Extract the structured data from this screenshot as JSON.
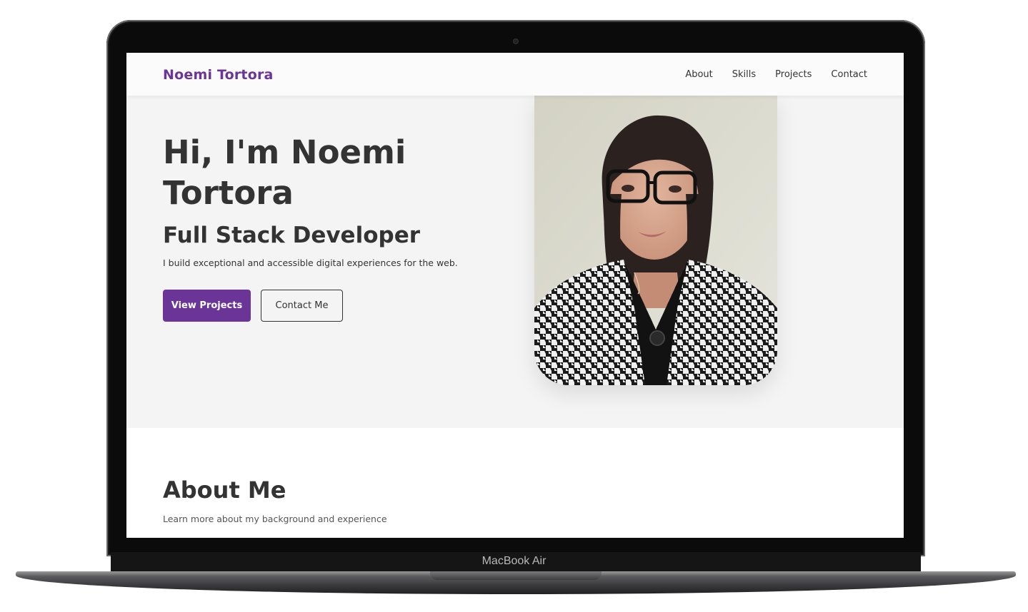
{
  "device": {
    "model_label": "MacBook Air"
  },
  "navbar": {
    "brand": "Noemi Tortora",
    "links": [
      "About",
      "Skills",
      "Projects",
      "Contact"
    ]
  },
  "hero": {
    "title": "Hi, I'm Noemi Tortora",
    "subtitle": "Full Stack Developer",
    "description": "I build exceptional and accessible digital experiences for the web.",
    "primary_button": "View Projects",
    "secondary_button": "Contact Me"
  },
  "about": {
    "title": "About Me",
    "subtitle": "Learn more about my background and experience"
  },
  "colors": {
    "accent": "#6a3597",
    "text": "#333333",
    "hero_background": "#f4f4f4"
  }
}
